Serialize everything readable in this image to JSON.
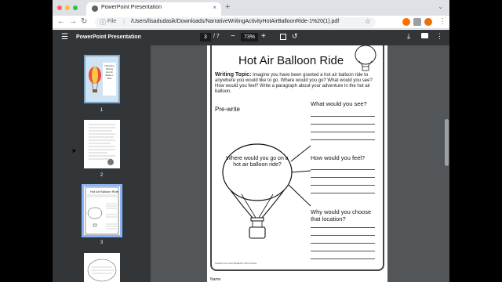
{
  "browser": {
    "tab_title": "PowerPoint Presentation",
    "tab_close": "×",
    "new_tab": "+",
    "omnibox_scheme": "File",
    "url": "/Users/lisadudasik/Downloads/NarrativeWritingActivityHotAirBalloonRide-1%20(1).pdf",
    "back_icon": "←",
    "forward_icon": "→",
    "reload_icon": "↻",
    "extension_colors": [
      "#ff6d00",
      "#5f6368",
      "#e8710a"
    ]
  },
  "pdf_toolbar": {
    "title": "PowerPoint Presentation",
    "current_page": "3",
    "total_pages": "/ 7",
    "zoom": "73%",
    "zoom_out": "−",
    "zoom_in": "+"
  },
  "sidebar": {
    "thumbnails": [
      {
        "label": "1"
      },
      {
        "label": "2"
      },
      {
        "label": "3"
      }
    ],
    "thumb1_title_lines": [
      "Narrative",
      "Writing",
      "Hot Air",
      "Balloon",
      "Ride"
    ]
  },
  "document": {
    "title": "Hot Air Balloon Ride",
    "topic_label": "Writing Topic:",
    "topic_text": "Imagine you have been granted a hot air balloon ride to anywhere you would like to go. Where would you go? What would you see? How would you feel? Write a paragraph about your adventure in the hot air balloon.",
    "prewrite": "Pre-write",
    "balloon_question": "Where would you go on a hot air balloon ride?",
    "q1": "What would you see?",
    "q2": "How would you feel?",
    "q3": "Why would you choose that location?",
    "footnote": "Graphic from Hot Metaphor with Kristine",
    "next_page_label": "Name"
  }
}
